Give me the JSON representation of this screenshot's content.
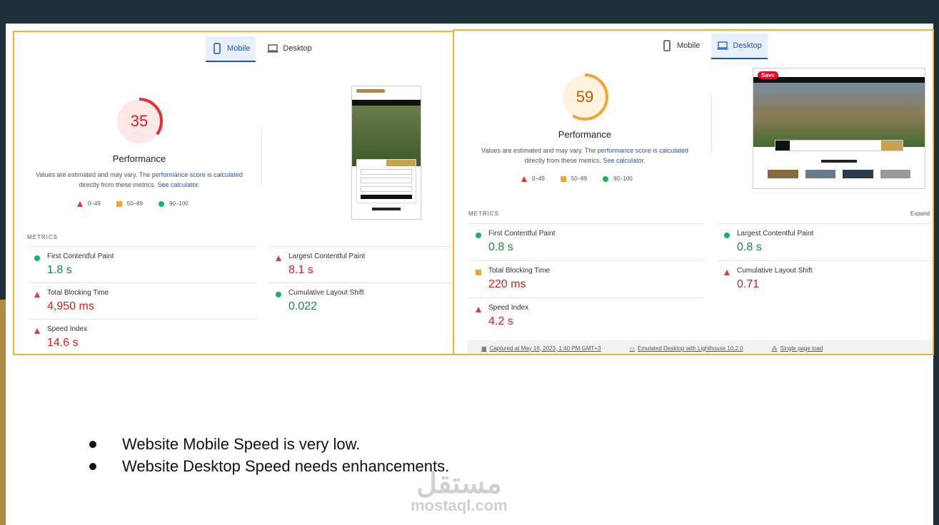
{
  "colors": {
    "accent_border": "#f2b233",
    "good": "#18b35a",
    "average": "#f2a532",
    "poor": "#e33333",
    "link": "#1a56c4"
  },
  "tabs": {
    "mobile": "Mobile",
    "desktop": "Desktop"
  },
  "mobile": {
    "score": "35",
    "score_fraction": 0.35,
    "performance_label": "Performance",
    "note_prefix": "Values are estimated and may vary. The ",
    "note_link": "performance score is calculated",
    "note_mid": " directly from these metrics. ",
    "note_calc": "See calculator.",
    "legend": [
      "0–49",
      "50–89",
      "90–100"
    ],
    "metrics_title": "METRICS",
    "metrics": [
      {
        "name": "First Contentful Paint",
        "value": "1.8 s",
        "status": "good"
      },
      {
        "name": "Largest Contentful Paint",
        "value": "8.1 s",
        "status": "poor"
      },
      {
        "name": "Total Blocking Time",
        "value": "4,950 ms",
        "status": "poor"
      },
      {
        "name": "Cumulative Layout Shift",
        "value": "0.022",
        "status": "good"
      },
      {
        "name": "Speed Index",
        "value": "14.6 s",
        "status": "poor"
      }
    ]
  },
  "desktop": {
    "score": "59",
    "score_fraction": 0.59,
    "performance_label": "Performance",
    "note_prefix": "Values are estimated and may vary. The ",
    "note_link": "performance score is calculated",
    "note_mid": " directly from these metrics. ",
    "note_calc": "See calculator.",
    "legend": [
      "0–49",
      "50–89",
      "90–100"
    ],
    "metrics_title": "METRICS",
    "expand": "Expand",
    "save_badge": "Save",
    "metrics": [
      {
        "name": "First Contentful Paint",
        "value": "0.8 s",
        "status": "good"
      },
      {
        "name": "Largest Contentful Paint",
        "value": "0.8 s",
        "status": "good"
      },
      {
        "name": "Total Blocking Time",
        "value": "220 ms",
        "status": "average"
      },
      {
        "name": "Cumulative Layout Shift",
        "value": "0.71",
        "status": "poor"
      },
      {
        "name": "Speed Index",
        "value": "4.2 s",
        "status": "poor"
      }
    ],
    "footer": {
      "captured": "Captured at May 16, 2023, 1:40 PM GMT+3",
      "emulated": "Emulated Desktop with Lighthouse 10.2.0",
      "single": "Single page load"
    }
  },
  "bullets": [
    "Website Mobile Speed is very low.",
    "Website Desktop Speed needs enhancements."
  ],
  "watermark": {
    "arabic": "مستقل",
    "latin": "mostaql.com"
  }
}
